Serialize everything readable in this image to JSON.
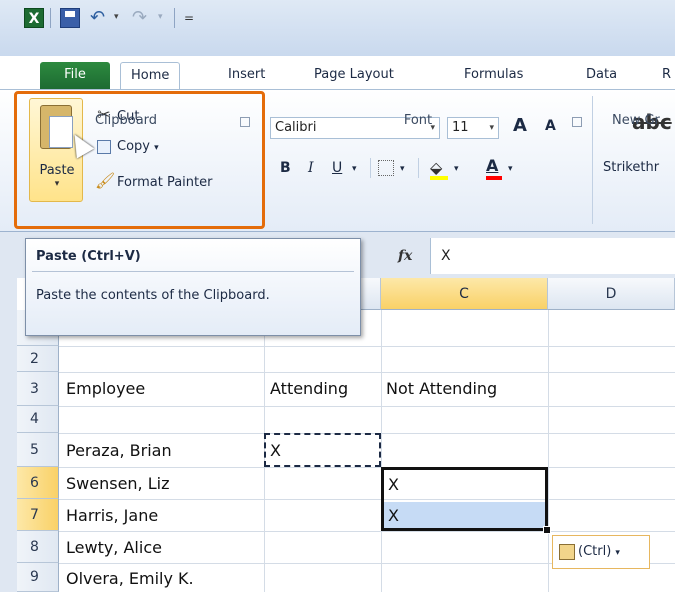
{
  "qat": {
    "app_icon": "excel-icon",
    "customize": "="
  },
  "tabs": [
    {
      "label": "File"
    },
    {
      "label": "Home"
    },
    {
      "label": "Insert"
    },
    {
      "label": "Page Layout"
    },
    {
      "label": "Formulas"
    },
    {
      "label": "Data"
    },
    {
      "label": "R"
    }
  ],
  "clipboard": {
    "paste": "Paste",
    "cut": "Cut",
    "copy": "Copy",
    "format_painter": "Format Painter",
    "group": "Clipboard"
  },
  "font": {
    "name": "Calibri",
    "size": "11",
    "grow": "A",
    "shrink": "A",
    "bold": "B",
    "italic": "I",
    "underline": "U",
    "color_letter": "A",
    "group": "Font"
  },
  "new_group": {
    "strike_sample": "abc",
    "strike_label": "Strikethr",
    "group": "New Gr"
  },
  "formula_bar": {
    "fx": "fx",
    "value": "X"
  },
  "columns": [
    {
      "letter": "C"
    },
    {
      "letter": "D"
    }
  ],
  "rows": [
    {
      "num": "2",
      "a": "",
      "b": "",
      "c": ""
    },
    {
      "num": "3",
      "a": "Employee",
      "b": "Attending",
      "c": "Not Attending"
    },
    {
      "num": "4",
      "a": "",
      "b": "",
      "c": ""
    },
    {
      "num": "5",
      "a": "Peraza, Brian",
      "b": "X",
      "c": ""
    },
    {
      "num": "6",
      "a": "Swensen, Liz",
      "b": "",
      "c": "X"
    },
    {
      "num": "7",
      "a": "Harris, Jane",
      "b": "",
      "c": "X"
    },
    {
      "num": "8",
      "a": "Lewty, Alice",
      "b": "",
      "c": ""
    },
    {
      "num": "9",
      "a": "Olvera, Emily K.",
      "b": "",
      "c": ""
    }
  ],
  "paste_options": {
    "label": "(Ctrl)"
  },
  "tooltip": {
    "title": "Paste (Ctrl+V)",
    "body": "Paste the contents of the Clipboard."
  },
  "colors": {
    "highlight": "#e46c0a",
    "file_tab": "#1d6b32",
    "selection": "#c6dbf5"
  }
}
